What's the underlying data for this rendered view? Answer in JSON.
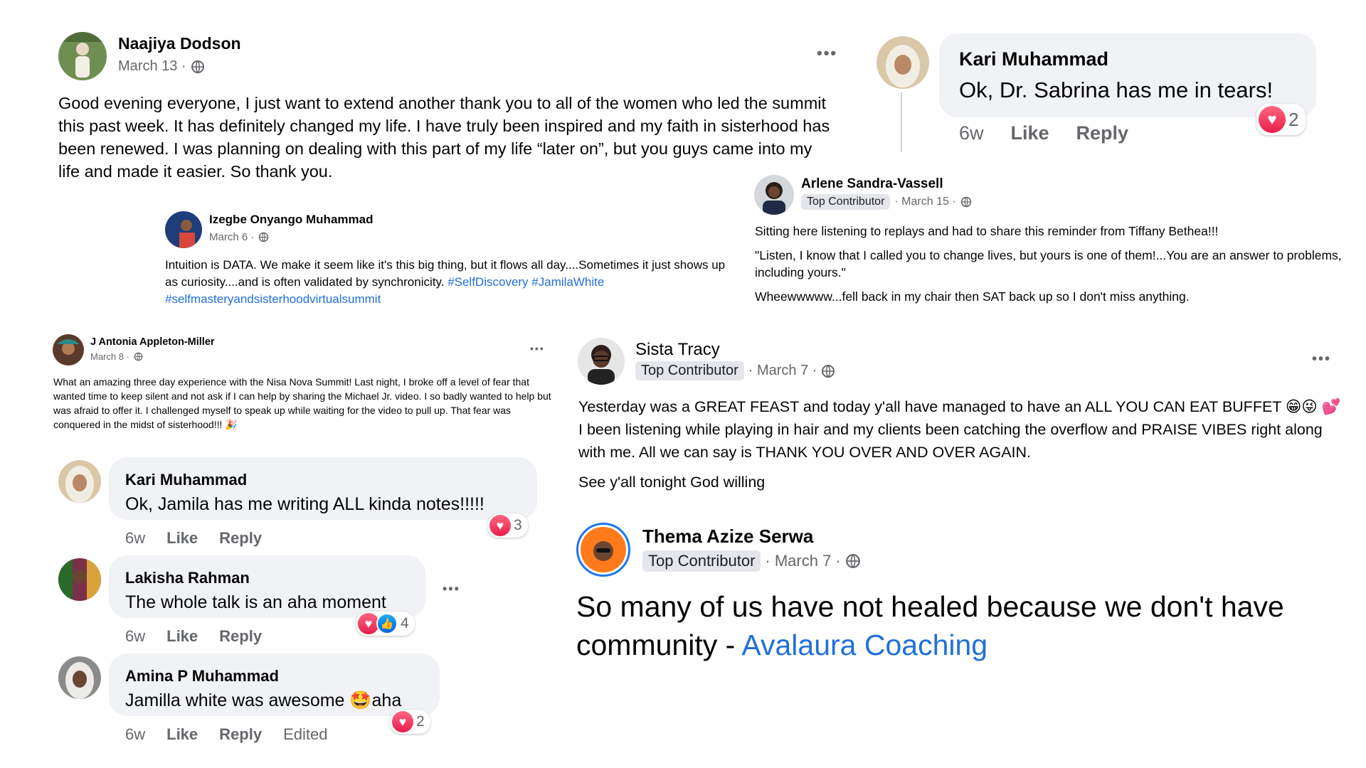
{
  "post1": {
    "author": "Naajiya Dodson",
    "date": "March 13 ·",
    "text": "Good evening everyone, I just want to extend another thank you to all of the women who led the summit this past week. It has definitely changed my life. I have truly been inspired and my faith in sisterhood has been renewed. I was planning on dealing with this part of my life “later on”, but you guys came into my life and made it easier. So thank you.",
    "more": "•••"
  },
  "comment_kari_top": {
    "author": "Kari Muhammad",
    "text": "Ok, Dr. Sabrina has me in tears!",
    "time": "6w",
    "like": "Like",
    "reply": "Reply",
    "reaction_count": "2"
  },
  "post_izegbe": {
    "author": "Izegbe Onyango Muhammad",
    "date": "March 6 ·",
    "text_part1": "Intuition is DATA. We make it seem like it's this big thing, but it flows all day....Sometimes it just shows up as curiosity....and is often validated by synchronicity.",
    "hashtag1": "#SelfDiscovery",
    "hashtag2": "#JamilaWhite",
    "hashtag3": "#selfmasteryandsisterhoodvirtualsummit"
  },
  "post_arlene": {
    "author": "Arlene Sandra-Vassell",
    "badge": "Top Contributor",
    "date": "· March 15 ·",
    "para1": "Sitting here listening to replays and had to share this reminder from Tiffany Bethea!!!",
    "para2": "\"Listen, I know that I called you to change lives, but yours is one of them!...You are an answer to problems, including yours.\"",
    "para3": "Wheewwwww...fell back in my chair then SAT back up so I don't miss anything."
  },
  "post_antonia": {
    "author": "J Antonia Appleton-Miller",
    "date": "March 8 ·",
    "text": "What an amazing three day experience with the Nisa Nova Summit! Last night, I broke off a level of fear that wanted time to keep silent and not ask if I can help by sharing the Michael Jr. video. I so badly wanted to help but was afraid to offer it. I challenged myself to speak up while waiting for the video to pull up. That fear was conquered in the midst of sisterhood!!! 🎉",
    "more": "•••"
  },
  "comments": [
    {
      "author": "Kari Muhammad",
      "text": "Ok, Jamila has me writing ALL kinda notes!!!!!",
      "time": "6w",
      "like": "Like",
      "reply": "Reply",
      "reaction_count": "3"
    },
    {
      "author": "Lakisha Rahman",
      "text": "The whole talk is an aha moment",
      "time": "6w",
      "like": "Like",
      "reply": "Reply",
      "reaction_count": "4",
      "more": "•••"
    },
    {
      "author": "Amina P Muhammad",
      "text": "Jamilla white was awesome 🤩aha",
      "time": "6w",
      "like": "Like",
      "reply": "Reply",
      "edited": "Edited",
      "reaction_count": "2"
    }
  ],
  "post_sista": {
    "author": "Sista Tracy",
    "badge": "Top Contributor",
    "date": "· March 7 ·",
    "para1": "Yesterday was a GREAT FEAST and today y'all have managed to have an ALL YOU CAN EAT BUFFET 😁😜 💕 I been listening while playing in hair and my clients been catching the overflow and PRAISE VIBES right along with me. All we can say is THANK YOU OVER AND OVER AGAIN.",
    "para2": "See y'all tonight God willing",
    "more": "•••"
  },
  "post_thema": {
    "author": "Thema Azize Serwa",
    "badge": "Top Contributor",
    "date": "· March 7 ·",
    "text": "So many of us have not healed because we don't have community - ",
    "link": "Avalaura Coaching"
  },
  "colors": {
    "link": "#216fdb",
    "meta": "#65676b",
    "bubble": "#f0f2f5",
    "heart": "#e61e4d",
    "like": "#0165e1"
  }
}
